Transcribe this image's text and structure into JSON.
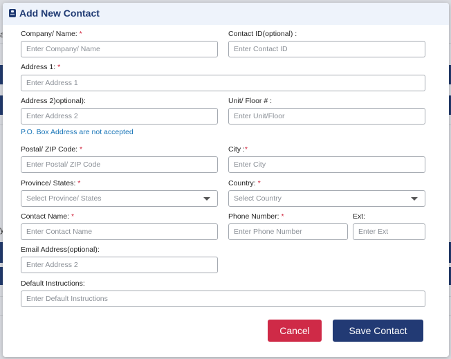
{
  "modal": {
    "title": "Add New Contact",
    "fields": {
      "company": {
        "label": "Company/ Name:",
        "required": "*",
        "placeholder": "Enter Company/ Name"
      },
      "contact_id": {
        "label": "Contact ID(optional) :",
        "placeholder": "Enter Contact ID"
      },
      "address1": {
        "label": "Address 1:",
        "required": "*",
        "placeholder": "Enter Address 1"
      },
      "address2": {
        "label": "Address 2)optional):",
        "placeholder": "Enter Address 2"
      },
      "unit_floor": {
        "label": "Unit/ Floor # :",
        "placeholder": "Enter Unit/Floor"
      },
      "po_box_note": "P.O. Box Address are not accepted",
      "postal": {
        "label": "Postal/ ZIP Code:",
        "required": "*",
        "placeholder": "Enter Postal/ ZIP Code"
      },
      "city": {
        "label": "City :",
        "required": "*",
        "placeholder": "Enter City"
      },
      "province": {
        "label": "Province/ States:",
        "required": "*",
        "placeholder": "Select Province/ States"
      },
      "country": {
        "label": "Country:",
        "required": "*",
        "placeholder": "Select Country"
      },
      "contact_name": {
        "label": "Contact Name:",
        "required": "*",
        "placeholder": "Enter Contact Name"
      },
      "phone": {
        "label": "Phone Number:",
        "required": "*",
        "placeholder": "Enter Phone Number"
      },
      "ext": {
        "label": "Ext:",
        "placeholder": "Enter Ext"
      },
      "email": {
        "label": "Email Address(optional):",
        "placeholder": "Enter Address 2"
      },
      "instructions": {
        "label": "Default Instructions:",
        "placeholder": "Enter Default Instructions"
      }
    },
    "buttons": {
      "cancel": "Cancel",
      "save": "Save Contact"
    }
  },
  "background": {
    "left_char_1": "a",
    "left_char_2": "y"
  },
  "colors": {
    "primary": "#223a74",
    "danger": "#cf2a47",
    "required": "#d0223a",
    "note": "#1a76b8",
    "header_bg": "#eef3fb"
  },
  "icons": {
    "header": "contact-card-icon",
    "dropdown": "caret-down-icon"
  }
}
